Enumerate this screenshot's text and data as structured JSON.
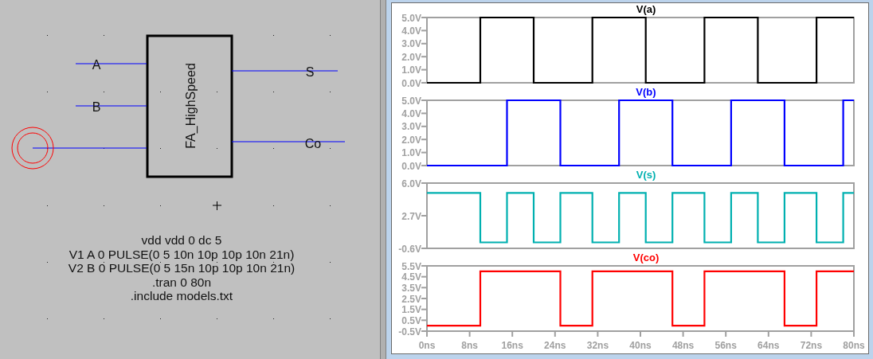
{
  "schematic": {
    "block": {
      "label": "FA_HighSpeed"
    },
    "pins": [
      {
        "label": "A"
      },
      {
        "label": "B"
      },
      {
        "label": "S"
      },
      {
        "label": "Co"
      }
    ],
    "netlist": [
      "vdd vdd 0 dc 5",
      "V1 A 0 PULSE(0 5 10n 10p 10p 10n 21n)",
      "V2 B 0 PULSE(0 5 15n 10p 10p 10n 21n)",
      ".tran 0 80n",
      ".include models.txt"
    ]
  },
  "plots": [
    {
      "chart_data": {
        "type": "line",
        "xlim": [
          0,
          80
        ],
        "ylim": [
          0,
          5
        ],
        "yticks": [
          {
            "value": 0,
            "label": "0.0V"
          },
          {
            "value": 1,
            "label": "1.0V"
          },
          {
            "value": 2,
            "label": "2.0V"
          },
          {
            "value": 3,
            "label": "3.0V"
          },
          {
            "value": 4,
            "label": "4.0V"
          },
          {
            "value": 5,
            "label": "5.0V"
          }
        ],
        "x": [
          0,
          10,
          10,
          20,
          20,
          31,
          31,
          41,
          41,
          52,
          52,
          62,
          62,
          73,
          73,
          80
        ],
        "series": [
          {
            "name": "V(a)",
            "color": "#000000",
            "values": [
              0,
              0,
              5,
              5,
              0,
              0,
              5,
              5,
              0,
              0,
              5,
              5,
              0,
              0,
              5,
              5
            ]
          }
        ]
      }
    },
    {
      "chart_data": {
        "type": "line",
        "xlim": [
          0,
          80
        ],
        "ylim": [
          0,
          5
        ],
        "yticks": [
          {
            "value": 0,
            "label": "0.0V"
          },
          {
            "value": 1,
            "label": "1.0V"
          },
          {
            "value": 2,
            "label": "2.0V"
          },
          {
            "value": 3,
            "label": "3.0V"
          },
          {
            "value": 4,
            "label": "4.0V"
          },
          {
            "value": 5,
            "label": "5.0V"
          }
        ],
        "x": [
          0,
          15,
          15,
          25,
          25,
          36,
          36,
          46,
          46,
          57,
          57,
          67,
          67,
          78,
          78,
          80
        ],
        "series": [
          {
            "name": "V(b)",
            "color": "#0000ff",
            "values": [
              0,
              0,
              5,
              5,
              0,
              0,
              5,
              5,
              0,
              0,
              5,
              5,
              0,
              0,
              5,
              5
            ]
          }
        ]
      }
    },
    {
      "chart_data": {
        "type": "line",
        "xlim": [
          0,
          80
        ],
        "ylim": [
          -0.6,
          6.0
        ],
        "yticks": [
          {
            "value": -0.6,
            "label": "-0.6V"
          },
          {
            "value": 2.7,
            "label": "2.7V"
          },
          {
            "value": 6.0,
            "label": "6.0V"
          }
        ],
        "x": [
          0,
          10,
          10,
          15,
          15,
          20,
          20,
          25,
          25,
          31,
          31,
          36,
          36,
          41,
          41,
          46,
          46,
          52,
          52,
          57,
          57,
          62,
          62,
          67,
          67,
          73,
          73,
          78,
          78,
          80
        ],
        "series": [
          {
            "name": "V(s)",
            "color": "#00b0b0",
            "values": [
              5,
              5,
              0,
              0,
              5,
              5,
              0,
              0,
              5,
              5,
              0,
              0,
              5,
              5,
              0,
              0,
              5,
              5,
              0,
              0,
              5,
              5,
              0,
              0,
              5,
              5,
              0,
              0,
              5,
              5
            ]
          }
        ]
      }
    },
    {
      "chart_data": {
        "type": "line",
        "xlim": [
          0,
          80
        ],
        "ylim": [
          -0.5,
          5.5
        ],
        "yticks": [
          {
            "value": -0.5,
            "label": "-0.5V"
          },
          {
            "value": 0.5,
            "label": "0.5V"
          },
          {
            "value": 1.5,
            "label": "1.5V"
          },
          {
            "value": 2.5,
            "label": "2.5V"
          },
          {
            "value": 3.5,
            "label": "3.5V"
          },
          {
            "value": 4.5,
            "label": "4.5V"
          },
          {
            "value": 5.5,
            "label": "5.5V"
          }
        ],
        "xticks": [
          {
            "value": 0,
            "label": "0ns"
          },
          {
            "value": 8,
            "label": "8ns"
          },
          {
            "value": 16,
            "label": "16ns"
          },
          {
            "value": 24,
            "label": "24ns"
          },
          {
            "value": 32,
            "label": "32ns"
          },
          {
            "value": 40,
            "label": "40ns"
          },
          {
            "value": 48,
            "label": "48ns"
          },
          {
            "value": 56,
            "label": "56ns"
          },
          {
            "value": 64,
            "label": "64ns"
          },
          {
            "value": 72,
            "label": "72ns"
          },
          {
            "value": 80,
            "label": "80ns"
          }
        ],
        "x": [
          0,
          10,
          10,
          25,
          25,
          31,
          31,
          46,
          46,
          52,
          52,
          67,
          67,
          73,
          73,
          80
        ],
        "series": [
          {
            "name": "V(co)",
            "color": "#ff0000",
            "values": [
              0,
              0,
              5,
              5,
              0,
              0,
              5,
              5,
              0,
              0,
              5,
              5,
              0,
              0,
              5,
              5
            ]
          }
        ]
      }
    }
  ]
}
